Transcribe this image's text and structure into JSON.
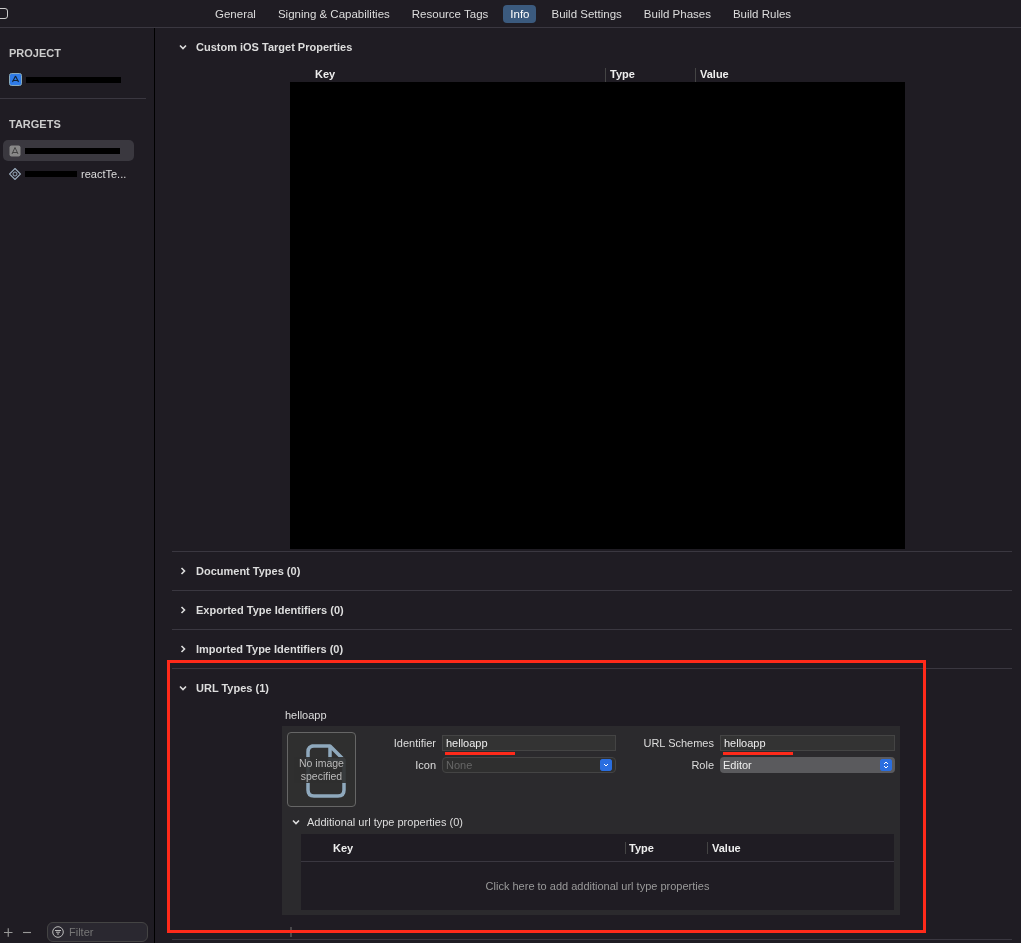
{
  "tabs": [
    {
      "label": "General",
      "selected": false
    },
    {
      "label": "Signing & Capabilities",
      "selected": false
    },
    {
      "label": "Resource Tags",
      "selected": false
    },
    {
      "label": "Info",
      "selected": true
    },
    {
      "label": "Build Settings",
      "selected": false
    },
    {
      "label": "Build Phases",
      "selected": false
    },
    {
      "label": "Build Rules",
      "selected": false
    }
  ],
  "sidebar": {
    "sections": [
      {
        "title": "PROJECT",
        "items": [
          {
            "kind": "project",
            "selected": false
          }
        ]
      },
      {
        "title": "TARGETS",
        "items": [
          {
            "kind": "app",
            "selected": true
          },
          {
            "kind": "test",
            "label": "reactTe...",
            "selected": false
          }
        ]
      }
    ],
    "filter": {
      "placeholder": "Filter"
    }
  },
  "sections": [
    {
      "title": "Custom iOS Target Properties",
      "expanded": true,
      "kind": "properties",
      "columns": [
        "Key",
        "Type",
        "Value"
      ]
    },
    {
      "title": "Document Types (0)",
      "expanded": false,
      "kind": "plain"
    },
    {
      "title": "Exported Type Identifiers (0)",
      "expanded": false,
      "kind": "plain"
    },
    {
      "title": "Imported Type Identifiers (0)",
      "expanded": false,
      "kind": "plain"
    },
    {
      "title": "URL Types (1)",
      "expanded": true,
      "kind": "url_types",
      "entry": {
        "name": "helloapp",
        "image_text": "No image specified",
        "identifier_label": "Identifier",
        "identifier": "helloapp",
        "icon_label": "Icon",
        "icon_placeholder": "None",
        "schemes_label": "URL Schemes",
        "schemes": "helloapp",
        "role_label": "Role",
        "role": "Editor",
        "additional": {
          "title": "Additional url type properties (0)",
          "expanded": true,
          "columns": [
            "Key",
            "Type",
            "Value"
          ],
          "empty_hint": "Click here to add additional url type properties"
        }
      }
    }
  ]
}
